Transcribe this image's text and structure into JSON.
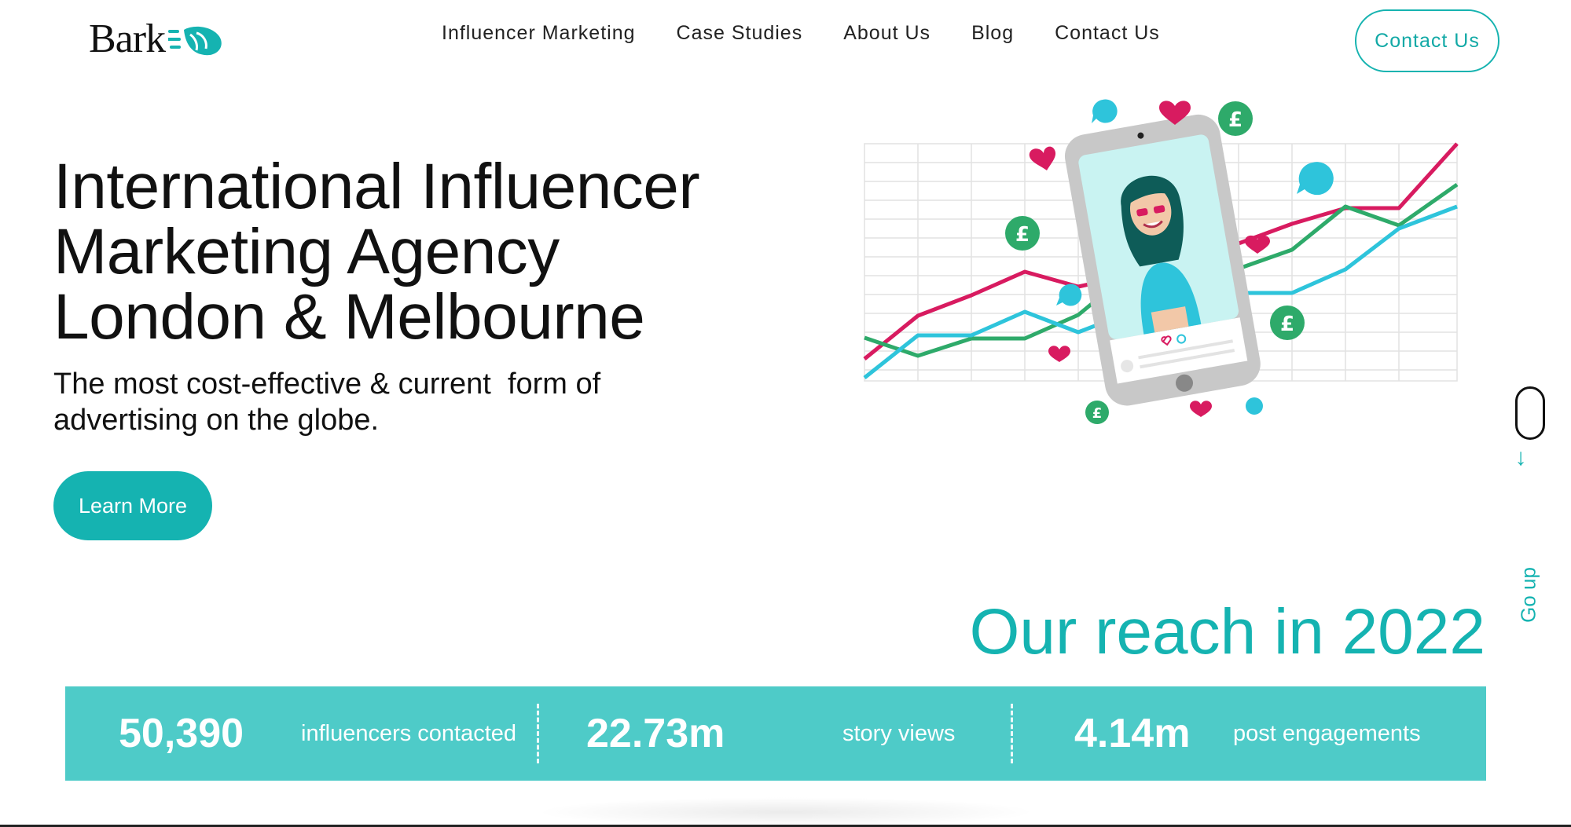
{
  "header": {
    "logo_text": "Bark",
    "nav": [
      "Influencer Marketing",
      "Case Studies",
      "About Us",
      "Blog",
      "Contact Us"
    ],
    "cta_label": "Contact Us"
  },
  "hero": {
    "title_lines": [
      "International Influencer",
      "Marketing Agency",
      "London & Melbourne"
    ],
    "subtitle_lines": [
      "The most cost-effective & current  form of",
      "advertising on the globe."
    ],
    "button_label": "Learn More"
  },
  "side": {
    "scroll_arrow": "↓",
    "go_up_label": "Go up"
  },
  "reach": {
    "title": "Our reach in 2022",
    "stats": [
      {
        "value": "50,390",
        "label": "influencers contacted"
      },
      {
        "value": "22.73m",
        "label": "story views"
      },
      {
        "value": "4.14m",
        "label": "post engagements"
      }
    ]
  },
  "colors": {
    "accent": "#15b3b1",
    "stats_bar": "#4ecbc8",
    "pink": "#d81b60",
    "green": "#2eaa6a",
    "blue": "#2ec4db"
  },
  "illustration": {
    "icons": [
      "heart-icon",
      "speech-bubble-icon",
      "pound-coin-icon",
      "smartphone-icon"
    ]
  }
}
